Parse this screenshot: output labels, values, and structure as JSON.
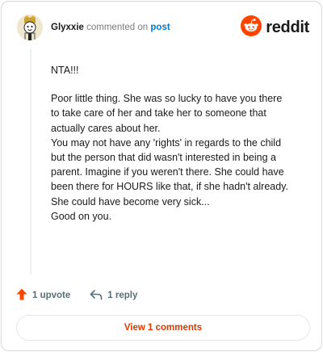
{
  "header": {
    "username": "Glyxxie",
    "verb": "commented on",
    "post_link": "post",
    "brand": "reddit"
  },
  "comment": {
    "paragraphs": [
      "NTA!!!",
      "Poor little thing. She was so lucky to have you there to take care of her and take her to someone that actually cares about her.",
      "You may not have any 'rights' in regards to the child but the person that did wasn't interested in being a parent. Imagine if you weren't there. She could have been there for HOURS like that, if she hadn't already. She could have become very sick...",
      "Good on you."
    ]
  },
  "actions": {
    "upvote_label": "1 upvote",
    "reply_label": "1 reply"
  },
  "view_comments_label": "View 1 comments",
  "icons": {
    "avatar": "avatar",
    "reddit_logo": "reddit-logo-icon",
    "upvote": "upvote-arrow-icon",
    "reply": "reply-arrow-icon"
  },
  "colors": {
    "brand_orange": "#ff4500",
    "upvote_orange": "#ff4500",
    "link_blue": "#0079d3",
    "button_text": "#d93a00",
    "muted": "#576f76"
  }
}
